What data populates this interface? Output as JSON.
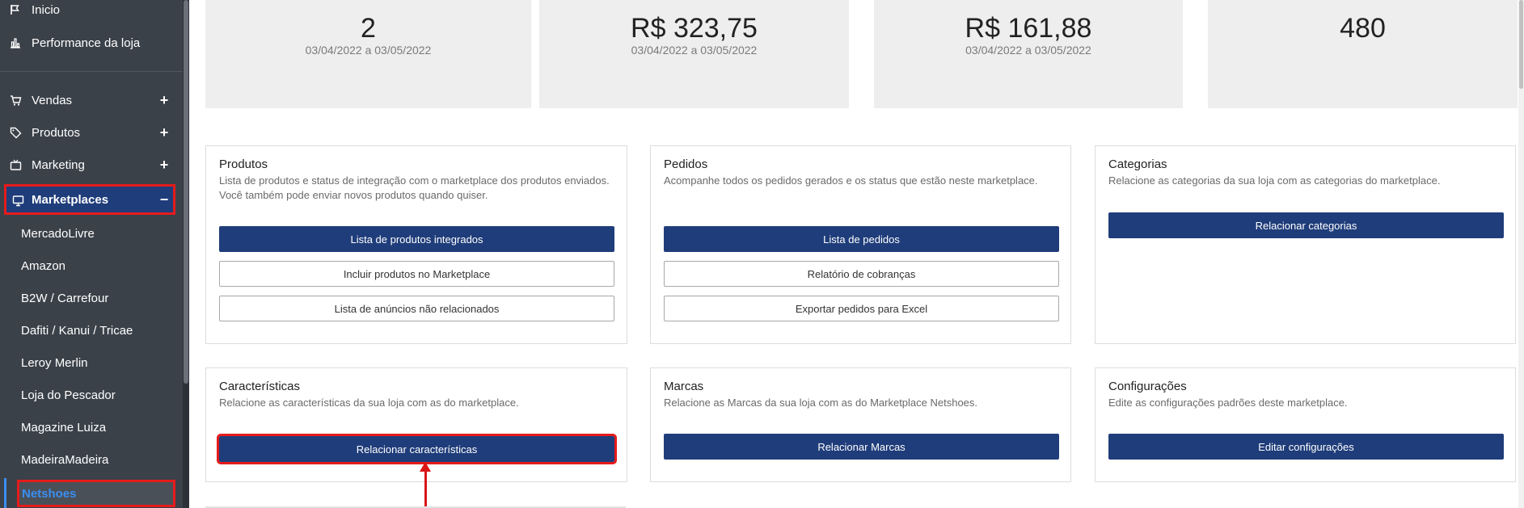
{
  "sidebar": {
    "top_items": [
      {
        "label": "Inicio",
        "icon": "flag-icon"
      },
      {
        "label": "Performance da loja",
        "icon": "bar-chart-icon"
      }
    ],
    "sections": [
      {
        "label": "Vendas",
        "icon": "cart-icon",
        "toggle": "+"
      },
      {
        "label": "Produtos",
        "icon": "tag-icon",
        "toggle": "+"
      },
      {
        "label": "Marketing",
        "icon": "tv-icon",
        "toggle": "+"
      },
      {
        "label": "Marketplaces",
        "icon": "monitor-icon",
        "toggle": "−"
      }
    ],
    "marketplaces": [
      "MercadoLivre",
      "Amazon",
      "B2W / Carrefour",
      "Dafiti / Kanui / Tricae",
      "Leroy Merlin",
      "Loja do Pescador",
      "Magazine Luiza",
      "MadeiraMadeira",
      "Netshoes"
    ]
  },
  "stats": [
    {
      "value": "2",
      "period": "03/04/2022 a 03/05/2022"
    },
    {
      "value": "R$ 323,75",
      "period": "03/04/2022 a 03/05/2022"
    },
    {
      "value": "R$ 161,88",
      "period": "03/04/2022 a 03/05/2022"
    },
    {
      "value": "480",
      "period": ""
    }
  ],
  "cards": {
    "produtos": {
      "title": "Produtos",
      "desc": "Lista de produtos e status de integração com o marketplace dos produtos enviados. Você também pode enviar novos produtos quando quiser.",
      "buttons": [
        "Lista de produtos integrados",
        "Incluir produtos no Marketplace",
        "Lista de anúncios não relacionados"
      ]
    },
    "pedidos": {
      "title": "Pedidos",
      "desc": "Acompanhe todos os pedidos gerados e os status que estão neste marketplace.",
      "buttons": [
        "Lista de pedidos",
        "Relatório de cobranças",
        "Exportar pedidos para Excel"
      ]
    },
    "categorias": {
      "title": "Categorias",
      "desc": "Relacione as categorias da sua loja com as categorias do marketplace.",
      "buttons": [
        "Relacionar categorias"
      ]
    },
    "caracteristicas": {
      "title": "Características",
      "desc": "Relacione as características da sua loja com as do marketplace.",
      "buttons": [
        "Relacionar características"
      ]
    },
    "marcas": {
      "title": "Marcas",
      "desc": "Relacione as Marcas da sua loja com as do Marketplace Netshoes.",
      "buttons": [
        "Relacionar Marcas"
      ]
    },
    "configuracoes": {
      "title": "Configurações",
      "desc": "Edite as configurações padrões deste marketplace.",
      "buttons": [
        "Editar configurações"
      ]
    }
  },
  "colors": {
    "sidebar_bg": "#3b4149",
    "primary": "#1f3d7a",
    "highlight": "#e51b1b",
    "active_link": "#3a8ef0"
  }
}
